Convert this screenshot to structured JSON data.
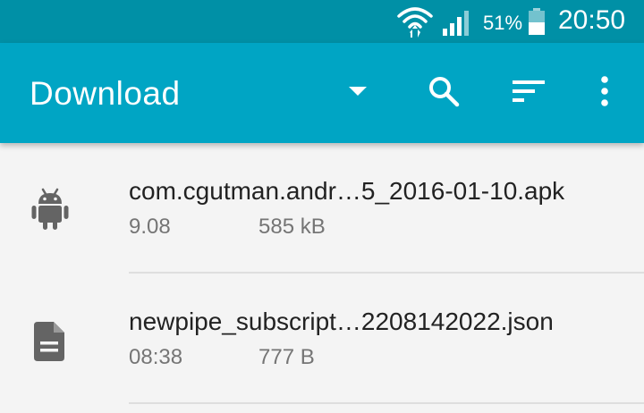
{
  "status_bar": {
    "battery_percent": "51%",
    "time": "20:50",
    "icons": [
      "wifi-icon",
      "signal-icon",
      "battery-icon"
    ]
  },
  "app_bar": {
    "title": "Download",
    "icons": [
      "dropdown-arrow-icon",
      "search-icon",
      "sort-icon",
      "more-vert-icon"
    ]
  },
  "files": [
    {
      "icon": "android-icon",
      "name": "com.cgutman.andr…5_2016-01-10.apk",
      "date": "9.08",
      "size": "585 kB"
    },
    {
      "icon": "document-icon",
      "name": "newpipe_subscript…2208142022.json",
      "date": "08:38",
      "size": "777 B"
    }
  ],
  "colors": {
    "status_bar": "#0090a6",
    "app_bar": "#00a5c4",
    "background": "#f4f4f4",
    "primary_text": "#222222",
    "secondary_text": "#757575",
    "icon_gray": "#646464"
  }
}
